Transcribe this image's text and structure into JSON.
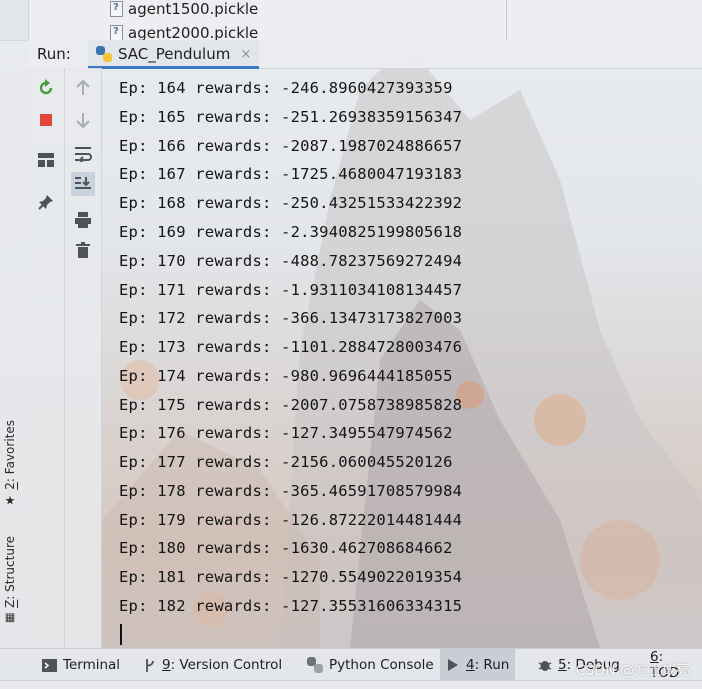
{
  "project_tree": {
    "items": [
      {
        "label": "agent1500.pickle"
      },
      {
        "label": "agent2000.pickle"
      }
    ]
  },
  "run_window": {
    "run_label": "Run:",
    "tab_label": "SAC_Pendulum",
    "tab_close": "×"
  },
  "side_stripe": {
    "favorites_number": "2",
    "favorites_label": ": Favorites",
    "structure_number": "Z",
    "structure_label": ": Structure"
  },
  "console": {
    "lines": [
      "Ep: 164 rewards: -246.8960427393359",
      "Ep: 165 rewards: -251.26938359156347",
      "Ep: 166 rewards: -2087.1987024886657",
      "Ep: 167 rewards: -1725.4680047193183",
      "Ep: 168 rewards: -250.43251533422392",
      "Ep: 169 rewards: -2.3940825199805618",
      "Ep: 170 rewards: -488.78237569272494",
      "Ep: 171 rewards: -1.9311034108134457",
      "Ep: 172 rewards: -366.13473173827003",
      "Ep: 173 rewards: -1101.2884728003476",
      "Ep: 174 rewards: -980.9696444185055",
      "Ep: 175 rewards: -2007.0758738985828",
      "Ep: 176 rewards: -127.3495547974562",
      "Ep: 177 rewards: -2156.060045520126",
      "Ep: 178 rewards: -365.46591708579984",
      "Ep: 179 rewards: -126.87222014481444",
      "Ep: 180 rewards: -1630.462708684662",
      "Ep: 181 rewards: -1270.5549022019354",
      "Ep: 182 rewards: -127.35531606334315"
    ]
  },
  "bottom_bar": {
    "terminal": "Terminal",
    "vcs_number": "9",
    "vcs_label": ": Version Control",
    "python_console": "Python Console",
    "run_number": "4",
    "run_label": ": Run",
    "debug_number": "5",
    "debug_label": ": Debug",
    "todo_number": "6",
    "todo_label": ": TOD"
  },
  "watermark": "CSDN @方土成亮",
  "colors": {
    "accent": "#3d77c8",
    "rerun_green": "#4a9a3e",
    "stop_red": "#e0473a"
  },
  "icons": {
    "rerun": "rerun-icon",
    "stop": "stop-icon",
    "layout": "layout-icon",
    "pin": "pin-icon",
    "up": "arrow-up-icon",
    "down": "arrow-down-icon",
    "wrap": "soft-wrap-icon",
    "scroll": "scroll-to-end-icon",
    "print": "print-icon",
    "trash": "trash-icon"
  }
}
